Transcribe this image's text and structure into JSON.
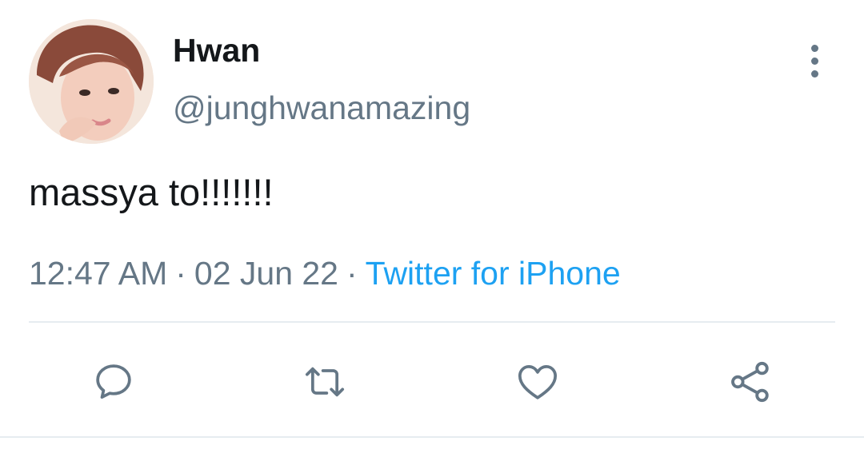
{
  "user": {
    "display_name": "Hwan",
    "handle": "@junghwanamazing"
  },
  "tweet": {
    "text": "massya to!!!!!!!"
  },
  "meta": {
    "time": "12:47 AM",
    "separator": "·",
    "date": "02 Jun 22",
    "source": "Twitter for iPhone"
  },
  "actions": [
    {
      "icon": "reply-icon"
    },
    {
      "icon": "retweet-icon"
    },
    {
      "icon": "like-icon"
    },
    {
      "icon": "share-icon"
    }
  ],
  "menu": {
    "icon": "more-vertical-icon"
  },
  "colors": {
    "text": "#14171a",
    "secondary": "#657786",
    "link": "#1da1f2",
    "divider": "#e6ecf0"
  }
}
